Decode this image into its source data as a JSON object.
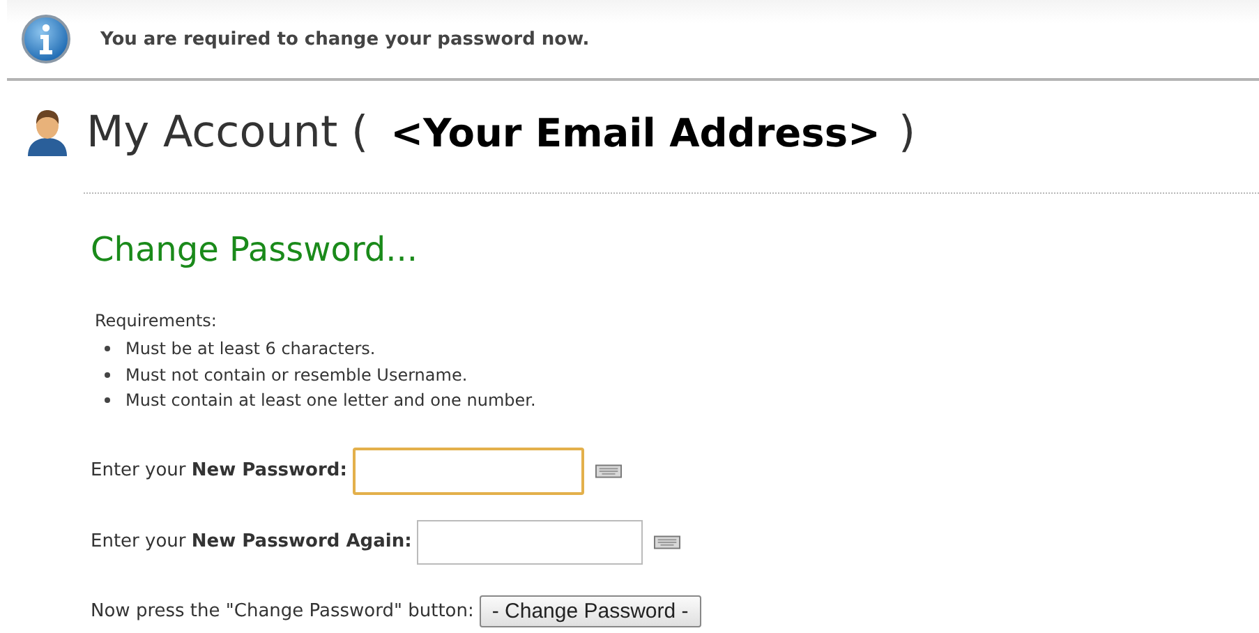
{
  "notice": {
    "message": "You are required to change your password now."
  },
  "header": {
    "title": "My Account (",
    "email": "<Your Email Address>",
    "title_end": ")"
  },
  "section_title": "Change Password...",
  "requirements": {
    "label": "Requirements:",
    "items": [
      "Must be at least 6 characters.",
      "Must not contain or resemble Username.",
      "Must contain at least one letter and one number."
    ]
  },
  "fields": [
    {
      "label": "Enter your **New Password:**",
      "focused": true
    },
    {
      "label": "Enter your **New Password Again:**",
      "focused": false
    }
  ],
  "submit": {
    "label": "Now press the \"Change Password\" button:",
    "button": "- Change Password -"
  }
}
